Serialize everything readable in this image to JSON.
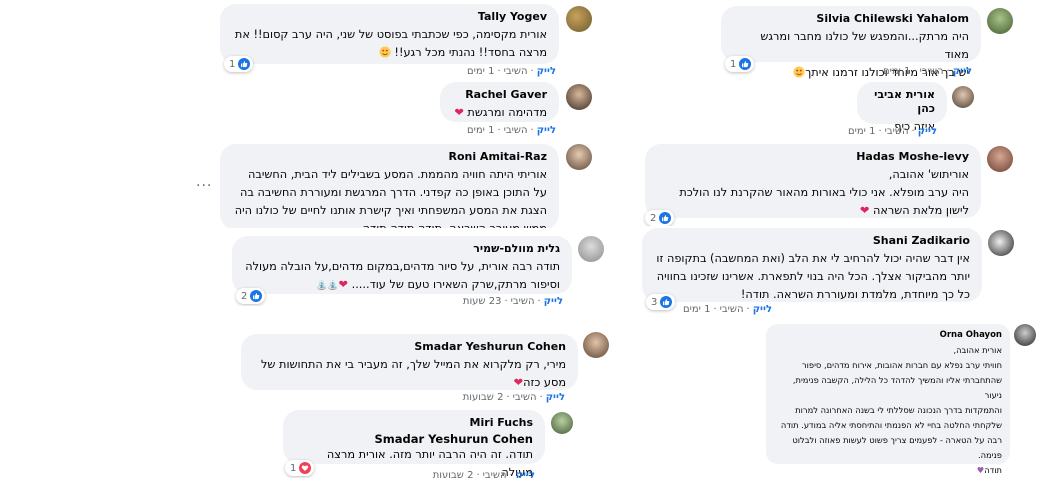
{
  "colors": {
    "like_blue": "#1b74e4",
    "heart_red": "#f33e58",
    "bubble_bg": "#f0f2f5",
    "meta_gray": "#65676b"
  },
  "actions": {
    "like": "לייק",
    "reply": "השיבי",
    "sep": "·"
  },
  "comments": {
    "tally": {
      "name": "Tally Yogev",
      "text": "אורית מקסימה, כפי שכתבתי בפוסט של שני, היה ערב קסום!! את\nמרצה בחסד!! נהנתי מכל רגע!!",
      "time": "1 ימים",
      "reactions": "1"
    },
    "rachel": {
      "name": "Rachel Gaver",
      "text": "מדהימה ומרגשת",
      "time": "1 ימים"
    },
    "roni": {
      "name": "Roni Amitai-Raz",
      "text": "אוריתי היתה חוויה מהממת. המסע בשבילים ליד הבית, החשיבה\nעל התוכן באופן כה קפדני. הדרך המרגשת ומעוררת החשיבה בה\nהצגת את המסע המשפחתי ואיך קישרת אותנו לחיים של כולנו היה\nממש מעורר השראה. תודה תודה תודה",
      "time": "1 ימים",
      "more": "···"
    },
    "galit": {
      "name": "גלית מוולם-שמיר",
      "text": "תודה רבה אורית, על סיור מדהים,במקום מדהים,על הובלה מעולה\nוסיפור מרתק,שרק השאירו טעם של עוד.....",
      "time": "23 שעות",
      "reactions": "2"
    },
    "silvia": {
      "name": "Silvia Chilewski Yahalom",
      "text": "היה מרתק...והמפגש של כולנו מחבר ומרגש מאוד\nיש בך אור מיוחד וכולנו זרמנו איתך",
      "time": "1 ימים",
      "reactions": "1"
    },
    "orit": {
      "name": "אורית אביבי כהן",
      "text": "איזה כיף",
      "time": "1 ימים"
    },
    "hadas": {
      "name": "Hadas Moshe-levy",
      "text": "אוריתוש' אהובה,\nהיה ערב מופלא. אני כולי באורות מהאור שהקרנת לנו  הולכת\nלישון מלאת השראה",
      "time": "1 ימים",
      "reactions": "2"
    },
    "shani": {
      "name": "Shani Zadikario",
      "text": "אין דבר שהיה יכול להרחיב לי את הלב (ואת המחשבה) בתקופה זו\nיותר מהביקור אצלך. הכל היה בנוי לתפארת. אשרינו שזכינו בחוויה\nכל כך מיוחדת, מלמדת ומעוררת השראה. תודה!",
      "time": "1 ימים",
      "reactions": "3"
    },
    "smadar": {
      "name": "Smadar Yeshurun Cohen",
      "text": "מירי, רק מלקרוא את המייל שלך, זה מעביר בי את התחושות של\nמסע כזה",
      "time": "2 שבועות"
    },
    "miri": {
      "name": "Miri Fuchs",
      "mention": "Smadar Yeshurun Cohen",
      "text": "תודה. זה היה הרבה יותר מזה. אורית מרצה מעולה",
      "time": "2 שבועות",
      "reactions": "1"
    },
    "orna": {
      "name": "Orna Ohayon",
      "text": "אורית אהובה,\nחוויתי ערב נפלא עם חברות אהובות, אירוח מדהים, סיפור\nשהתחברתי אליו והמשיך להדהד כל הלילה, הקשבה פנימית, ניעור\nוהתמקדות בדרך הנכונה שסללתי לי בשנה האחרונה למרות\nשלקחתי החלטה בחיי לא הפנמתי והתיחסתי אליה במודע. תודה\nרבה על הטארה - לפעמים צריך פשוט לעשות פאוזה ולבלוט פנימה.\nתודה"
    }
  }
}
